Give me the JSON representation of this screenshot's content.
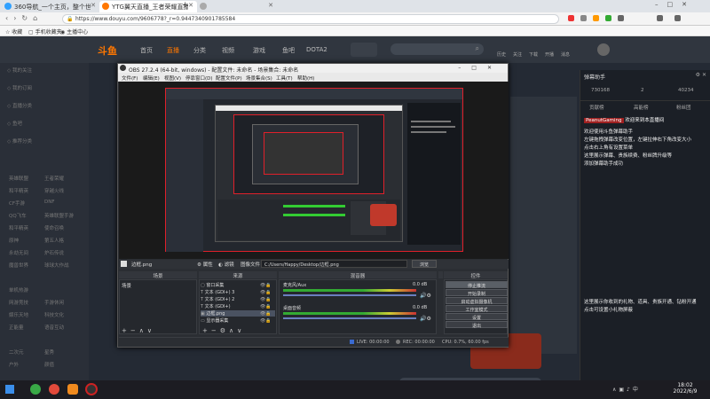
{
  "browser": {
    "tabs": [
      {
        "label": "360导航_一个主页，整个世界",
        "active": false
      },
      {
        "label": "YTG翼天直播_王者荣耀直播_",
        "active": true
      },
      {
        "label": "",
        "active": false
      }
    ],
    "url": "https://www.douyu.com/9606778?_r=0.9447340901785584",
    "bookmarks": [
      "收藏",
      "手机收藏夹",
      "主播中心"
    ]
  },
  "site": {
    "logo": "斗鱼",
    "nav": [
      "首页",
      "直播",
      "分类",
      "视频",
      "游戏",
      "鱼吧",
      "DOTA2"
    ],
    "top_right": [
      "历史",
      "关注",
      "下载",
      "开播",
      "消息",
      "登录"
    ],
    "left_menu": [
      "我的关注",
      "我的订阅",
      "直播分类",
      "鱼吧",
      "推荐分类",
      "英雄联盟",
      "王者荣耀",
      "和平精英",
      "穿越火线",
      "CF手游",
      "DNF",
      "QQ飞车",
      "英雄联盟手游",
      "和平精英",
      "使命召唤",
      "原神",
      "第五人格",
      "永劫无间",
      "炉石传说",
      "魔兽世界",
      "球球大作战",
      "单机热游",
      "网游竞技",
      "手游休闲",
      "娱乐天地",
      "科技文化",
      "正能量",
      "语音互动",
      "二次元",
      "星秀",
      "户外",
      "颜值"
    ]
  },
  "chat": {
    "header": "弹幕助手",
    "stats": [
      "730168",
      "2",
      "40234"
    ],
    "tabs": [
      "贡献榜",
      "高能榜",
      "粉丝团"
    ],
    "welcome_user": "PeanutGaming",
    "welcome_msg": "欢迎来到本直播间",
    "msg1": "欢迎使用斗鱼弹幕助手\n左键拖拽弹幕改变位置，左键拉伸右下角改变大小\n点击右上角有设置菜单\n这里展示弹幕、贵族续费、粉丝牌升级等\n添加弹幕助手成功",
    "msg2": "这里展示你收到的礼物、道具、贵族开通、钻粉开通\n点击可设置小礼物屏蔽"
  },
  "obs": {
    "title": "OBS 27.2.4 (64-bit, windows) - 配置文件: 未命名 - 场景集合: 未命名",
    "menu": [
      "文件(F)",
      "编辑(E)",
      "视图(V)",
      "停靠窗口(D)",
      "配置文件(P)",
      "场景集合(S)",
      "工具(T)",
      "帮助(H)"
    ],
    "source_bar": {
      "name": "边框.png",
      "props": "属性",
      "filters": "滤镜",
      "img_label": "图像文件",
      "path": "C:/Users/Happy/Desktop/边框.png",
      "browse": "浏览"
    },
    "panels": {
      "scenes": "场景",
      "sources": "来源",
      "mixer": "混音器",
      "transitions": "场景转换",
      "controls": "控件"
    },
    "scene_items": [
      "场景"
    ],
    "source_items": [
      "窗口采集",
      "文本 (GDI+) 3",
      "文本 (GDI+) 2",
      "文本 (GDI+)",
      "边框.png",
      "显示器采集"
    ],
    "mixer": [
      {
        "name": "麦克风/Aux",
        "db": "0.0 dB"
      },
      {
        "name": "桌面音频",
        "db": "0.0 dB"
      }
    ],
    "buttons": [
      "停止推流",
      "开始录制",
      "启动虚拟摄像机",
      "工作室模式",
      "设置",
      "退出"
    ],
    "status": {
      "live": "LIVE: 00:00:00",
      "rec": "REC: 00:00:00",
      "cpu": "CPU: 0.7%, 60.00 fps"
    }
  },
  "taskbar": {
    "time": "18:02",
    "date": "2022/6/9"
  },
  "colors": {
    "douyu_orange": "#ff7700",
    "obs_bg": "#2b2e33",
    "red_border": "#e0202a"
  }
}
